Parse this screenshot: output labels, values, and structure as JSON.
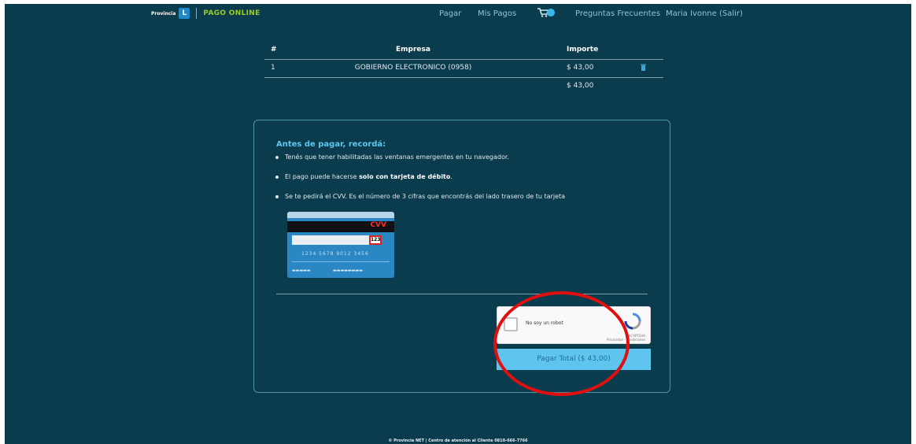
{
  "header": {
    "logo_provincia": "Provincia",
    "logo_sub": "NET",
    "logo_text": "PAGO ONLINE",
    "nav": {
      "pagar": "Pagar",
      "mis_pagos": "Mis Pagos",
      "faq": "Preguntas Frecuentes",
      "user": "Maria Ivonne (Salir)"
    }
  },
  "table": {
    "headers": {
      "num": "#",
      "empresa": "Empresa",
      "importe": "Importe"
    },
    "rows": [
      {
        "num": "1",
        "empresa": "GOBIERNO ELECTRONICO (0958)",
        "importe": "$ 43,00"
      }
    ],
    "total": "$ 43,00"
  },
  "panel": {
    "title": "Antes de pagar, recordá:",
    "bullet1": "Tenés que tener habilitadas las ventanas emergentes en tu navegador.",
    "bullet2_prefix": "El pago puede hacerse ",
    "bullet2_bold": "solo con tarjeta de débito",
    "bullet2_suffix": ".",
    "bullet3": "Se te pedirá el CVV. Es el número de 3 cifras que encontrás del lado trasero de tu tarjeta",
    "card": {
      "cvv_label": "CVV",
      "cvv_code": "123",
      "number": "1234 5678 9012 3456"
    },
    "captcha": {
      "label": "No soy un robot",
      "brand": "reCAPTCHA",
      "legal": "Privacidad - Condiciones"
    },
    "pay_button": "Pagar Total ($ 43,00)"
  },
  "footer": {
    "text": "© Provincia NET | Centro de atención al Cliente 0810-666-7766"
  },
  "colors": {
    "background": "#0b3c4d",
    "accent": "#5fc5ee",
    "logo_green": "#9ccb2c",
    "highlight_ring": "#e01010"
  }
}
